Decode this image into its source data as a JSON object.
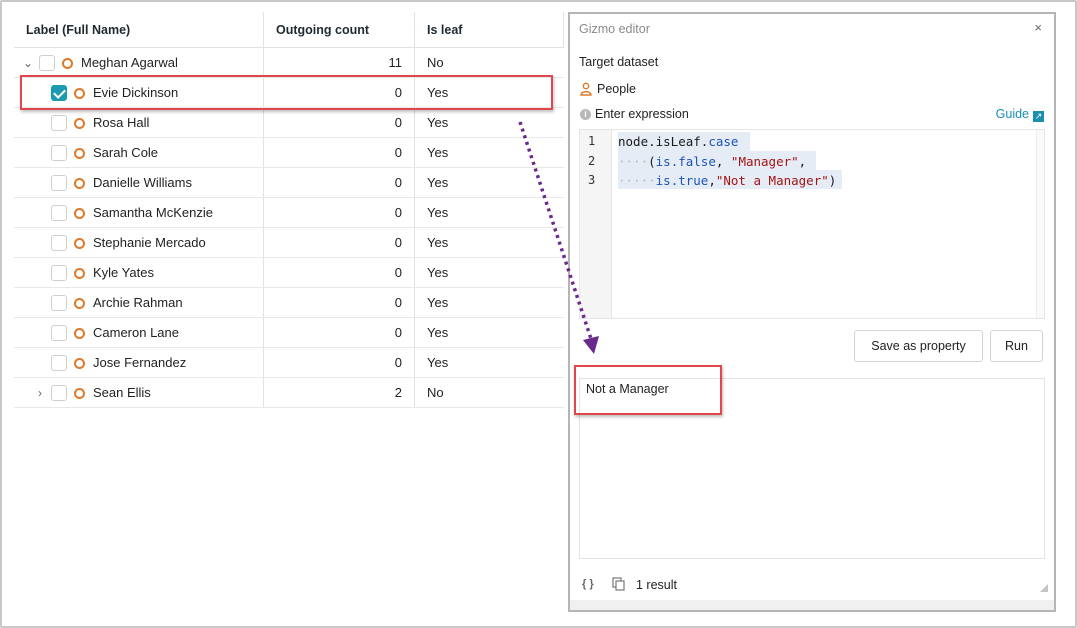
{
  "table": {
    "headers": {
      "label": "Label (Full Name)",
      "outgoing": "Outgoing count",
      "is_leaf": "Is leaf"
    },
    "rows": [
      {
        "name": "Meghan Agarwal",
        "outgoing": "11",
        "is_leaf": "No",
        "expand": "expanded",
        "checked": false
      },
      {
        "name": "Evie Dickinson",
        "outgoing": "0",
        "is_leaf": "Yes",
        "expand": "none",
        "checked": true
      },
      {
        "name": "Rosa Hall",
        "outgoing": "0",
        "is_leaf": "Yes",
        "expand": "none",
        "checked": false
      },
      {
        "name": "Sarah Cole",
        "outgoing": "0",
        "is_leaf": "Yes",
        "expand": "none",
        "checked": false
      },
      {
        "name": "Danielle Williams",
        "outgoing": "0",
        "is_leaf": "Yes",
        "expand": "none",
        "checked": false
      },
      {
        "name": "Samantha McKenzie",
        "outgoing": "0",
        "is_leaf": "Yes",
        "expand": "none",
        "checked": false
      },
      {
        "name": "Stephanie Mercado",
        "outgoing": "0",
        "is_leaf": "Yes",
        "expand": "none",
        "checked": false
      },
      {
        "name": "Kyle Yates",
        "outgoing": "0",
        "is_leaf": "Yes",
        "expand": "none",
        "checked": false
      },
      {
        "name": "Archie Rahman",
        "outgoing": "0",
        "is_leaf": "Yes",
        "expand": "none",
        "checked": false
      },
      {
        "name": "Cameron Lane",
        "outgoing": "0",
        "is_leaf": "Yes",
        "expand": "none",
        "checked": false
      },
      {
        "name": "Jose Fernandez",
        "outgoing": "0",
        "is_leaf": "Yes",
        "expand": "none",
        "checked": false
      },
      {
        "name": "Sean Ellis",
        "outgoing": "2",
        "is_leaf": "No",
        "expand": "collapsed",
        "checked": false
      }
    ]
  },
  "panel": {
    "title": "Gizmo editor",
    "close": "×",
    "target_dataset_label": "Target dataset",
    "dataset": "People",
    "expression_label": "Enter expression",
    "guide_link": "Guide",
    "code_lines": [
      {
        "num": "1",
        "parts": [
          [
            "",
            "node.isLeaf."
          ],
          [
            "kw",
            "case"
          ]
        ]
      },
      {
        "num": "2",
        "parts": [
          [
            "dots",
            "····"
          ],
          [
            "",
            "("
          ],
          [
            "kw",
            "is.false"
          ],
          [
            "",
            ", "
          ],
          [
            "str",
            "\"Manager\""
          ],
          [
            "",
            ","
          ]
        ]
      },
      {
        "num": "3",
        "parts": [
          [
            "dots",
            "·····"
          ],
          [
            "kw",
            "is.true"
          ],
          [
            "",
            ","
          ],
          [
            "str",
            "\"Not a Manager\""
          ],
          [
            "",
            ")"
          ]
        ]
      }
    ],
    "save_button": "Save as property",
    "run_button": "Run",
    "result_text": "Not a Manager",
    "footer_code_icon": "{ }",
    "results_count": "1 result"
  },
  "colors": {
    "accent": "#1a9bb0",
    "node_icon": "#e07a2a",
    "highlight_box": "#e0474c",
    "arrow": "#6a2a8c",
    "link": "#1a8fb0"
  },
  "icons": {
    "node": "circle-node-icon",
    "person": "person-icon",
    "info": "info-icon",
    "external": "external-link-icon",
    "copy": "copy-icon",
    "code": "code-braces-icon"
  }
}
